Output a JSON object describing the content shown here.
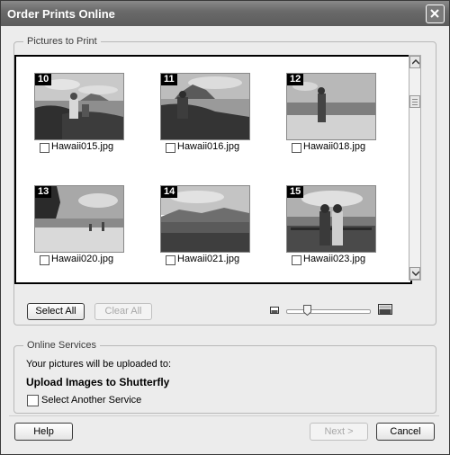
{
  "window": {
    "title": "Order Prints Online"
  },
  "pictures_group": {
    "legend": "Pictures to Print"
  },
  "photos": [
    {
      "number": "10",
      "filename": "Hawaii015.jpg",
      "checked": false
    },
    {
      "number": "11",
      "filename": "Hawaii016.jpg",
      "checked": false
    },
    {
      "number": "12",
      "filename": "Hawaii018.jpg",
      "checked": false
    },
    {
      "number": "13",
      "filename": "Hawaii020.jpg",
      "checked": false
    },
    {
      "number": "14",
      "filename": "Hawaii021.jpg",
      "checked": false
    },
    {
      "number": "15",
      "filename": "Hawaii023.jpg",
      "checked": false
    }
  ],
  "buttons": {
    "select_all": "Select All",
    "clear_all": "Clear All",
    "help": "Help",
    "next": "Next >",
    "cancel": "Cancel"
  },
  "services_group": {
    "legend": "Online Services",
    "upload_notice": "Your pictures will be uploaded to:",
    "service_name": "Upload Images to Shutterfly",
    "select_another": "Select Another Service",
    "select_another_checked": false
  },
  "thumbnail_size": 0.28
}
